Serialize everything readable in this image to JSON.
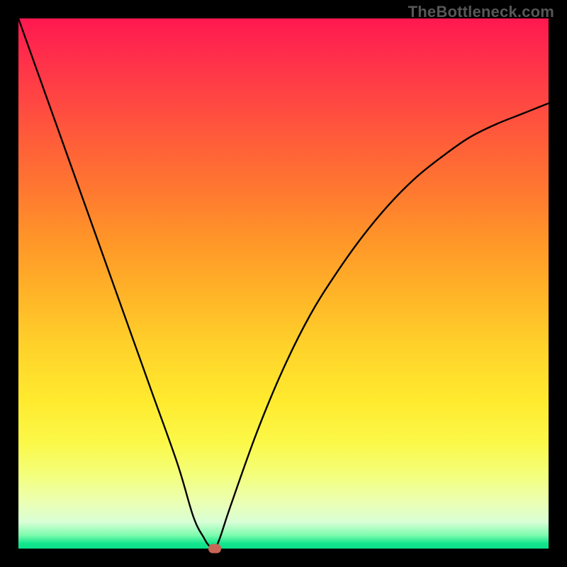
{
  "watermark": "TheBottleneck.com",
  "chart_data": {
    "type": "line",
    "title": "",
    "xlabel": "",
    "ylabel": "",
    "xlim": [
      0,
      100
    ],
    "ylim": [
      0,
      100
    ],
    "grid": false,
    "series": [
      {
        "name": "bottleneck-curve",
        "x": [
          0,
          5,
          10,
          15,
          20,
          25,
          30,
          33,
          35,
          36,
          37,
          38,
          40,
          45,
          50,
          55,
          60,
          65,
          70,
          75,
          80,
          85,
          90,
          95,
          100
        ],
        "values": [
          100,
          86,
          72,
          58,
          44,
          30,
          16,
          6,
          2,
          0.5,
          0,
          2,
          8,
          22,
          34,
          44,
          52,
          59,
          65,
          70,
          74,
          77.5,
          80,
          82,
          84
        ]
      }
    ],
    "marker": {
      "x": 37,
      "y": 0
    },
    "gradient_stops": [
      {
        "pos": 0,
        "color": "#ff1850"
      },
      {
        "pos": 50,
        "color": "#ffb428"
      },
      {
        "pos": 80,
        "color": "#fbf848"
      },
      {
        "pos": 100,
        "color": "#0be089"
      }
    ]
  }
}
